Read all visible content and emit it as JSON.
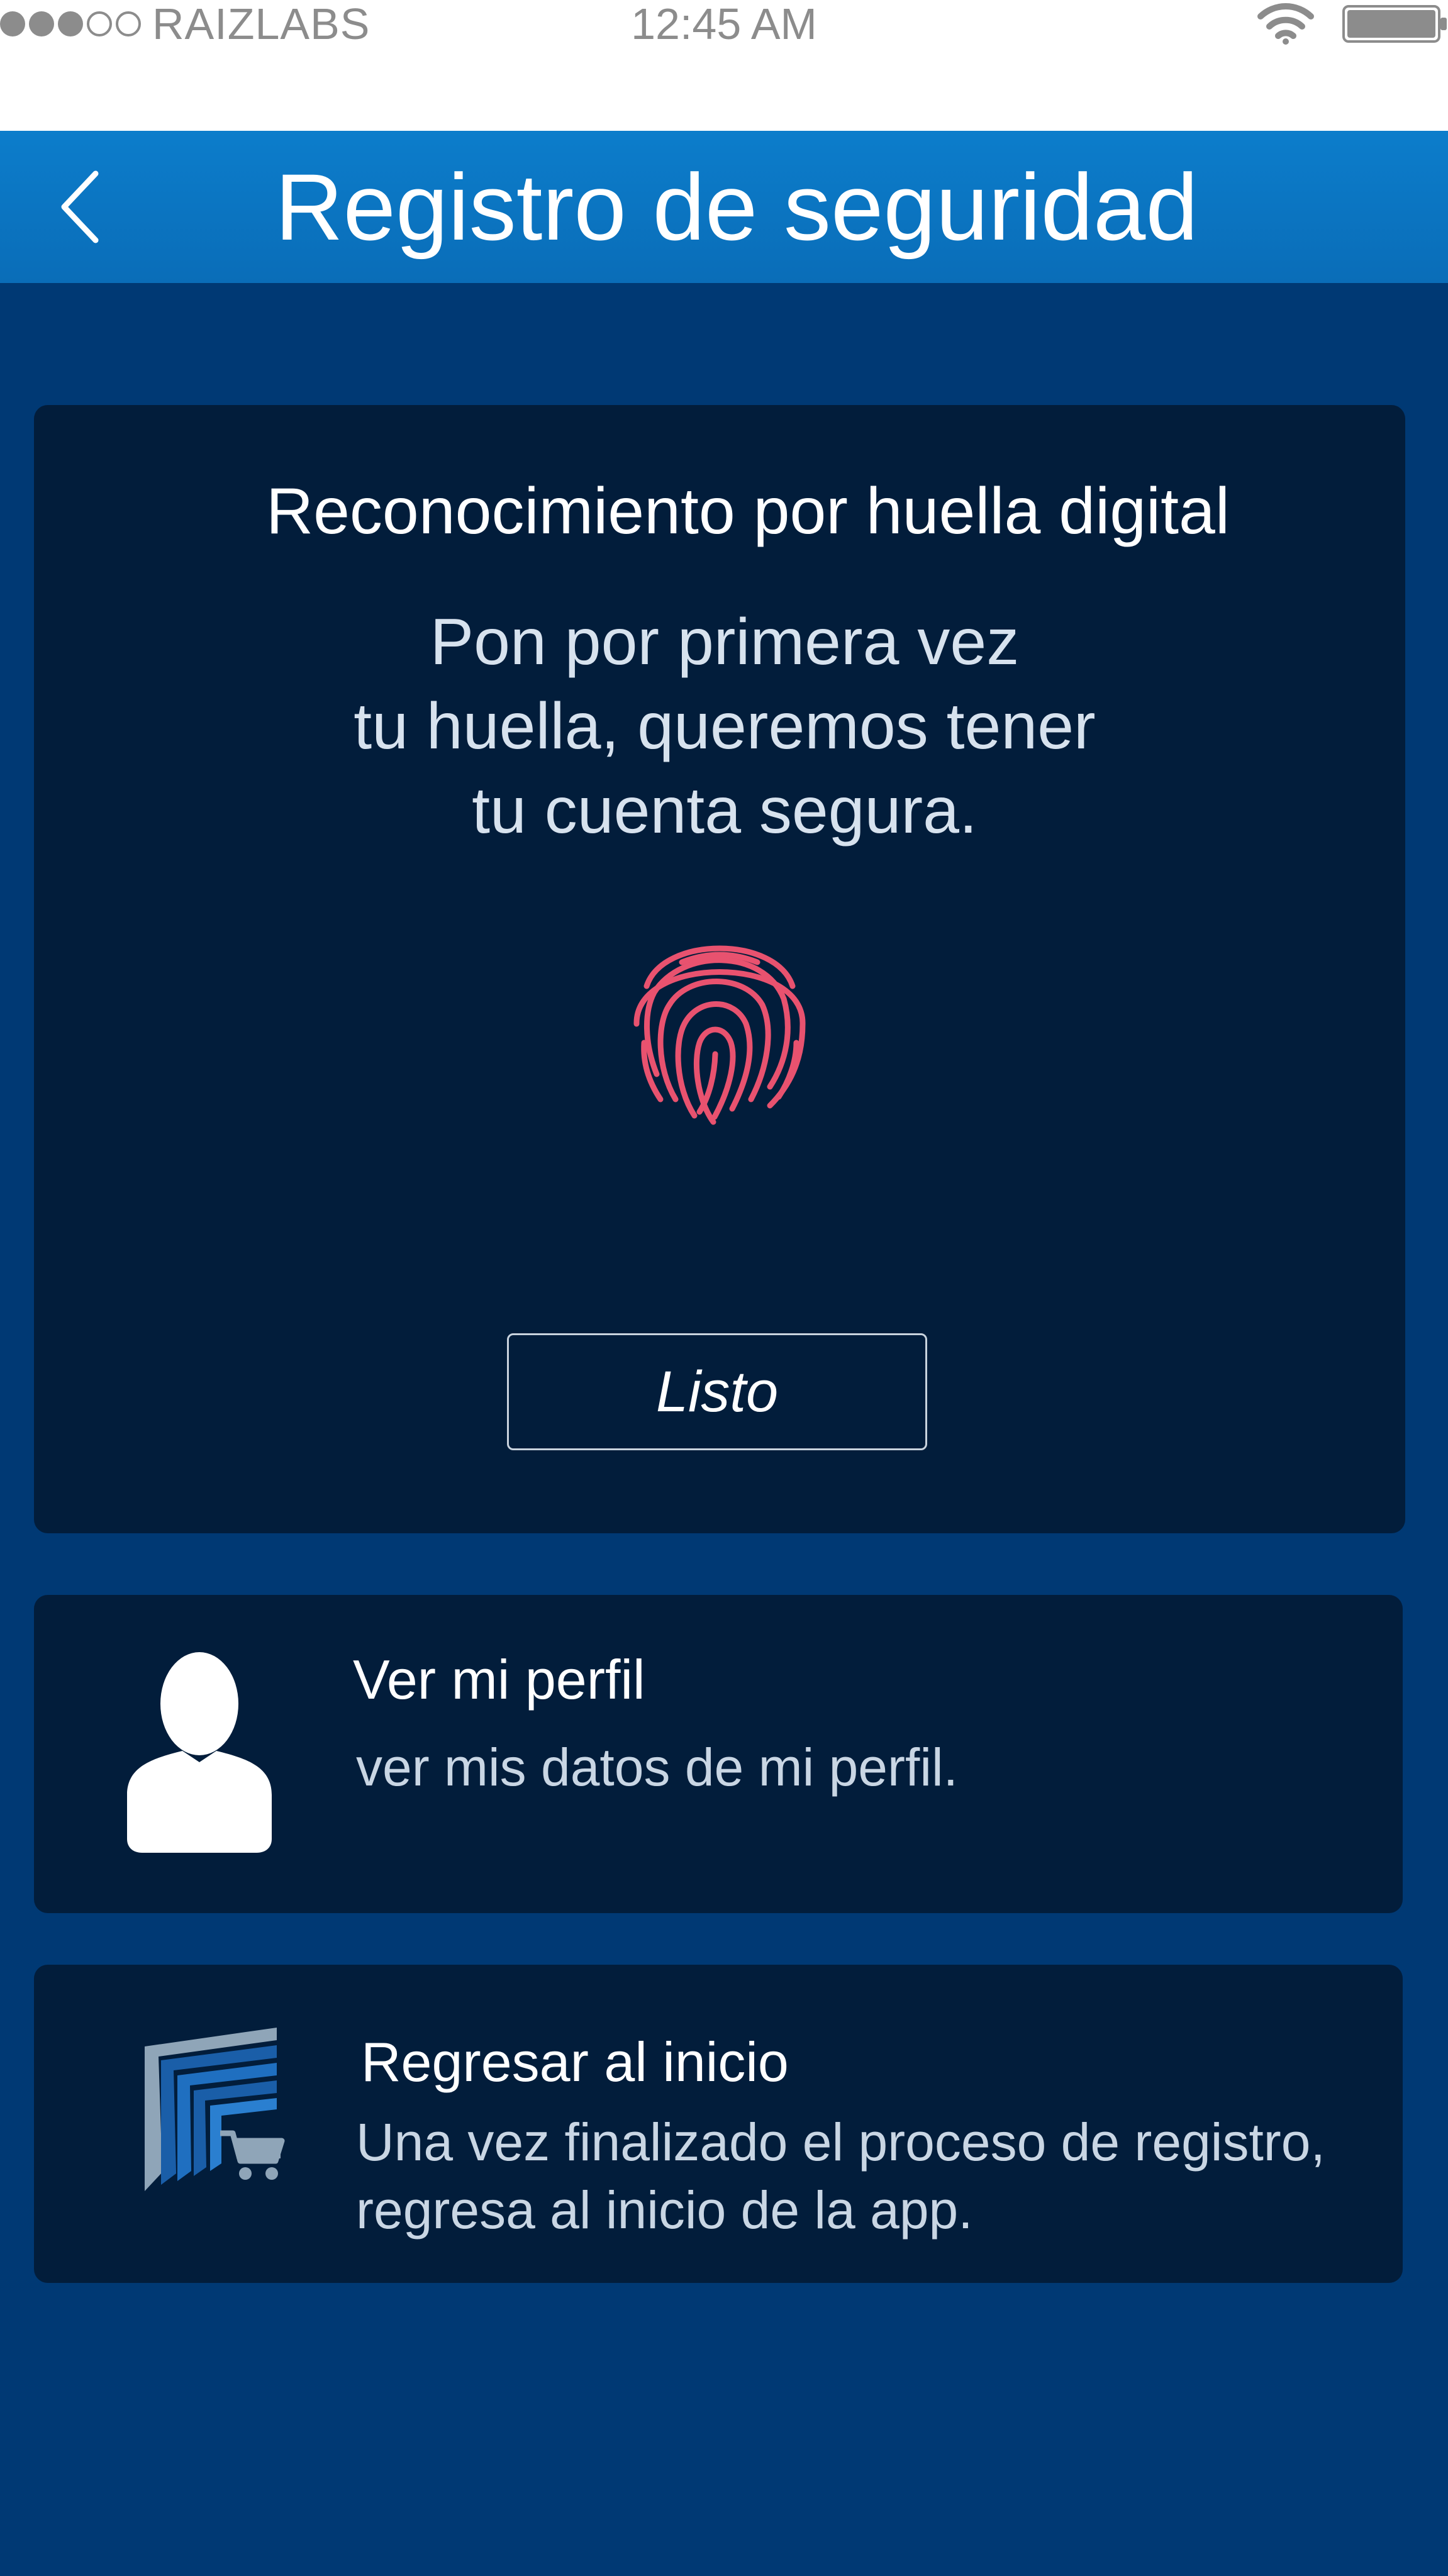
{
  "status_bar": {
    "carrier": "RAIZLABS",
    "time": "12:45 AM",
    "signal_bars_filled": 3,
    "signal_bars_total": 5
  },
  "header": {
    "title": "Registro de seguridad",
    "back_icon": "chevron-left-icon"
  },
  "fingerprint_card": {
    "title": "Reconocimiento por huella digital",
    "description": "Pon por primera vez\ntu huella, queremos tener\ntu cuenta segura.",
    "icon": "fingerprint-icon",
    "done_label": "Listo"
  },
  "profile_card": {
    "icon": "user-icon",
    "title": "Ver mi perfil",
    "description": "ver mis datos de mi perfil."
  },
  "home_card": {
    "icon": "store-cart-icon",
    "title": "Regresar al inicio",
    "description": "Una vez finalizado el proceso de registro,\nregresa al inicio de la app."
  },
  "colors": {
    "header": "#0a6db8",
    "background": "#003974",
    "card": "#021d3b",
    "fingerprint": "#e8526f"
  }
}
